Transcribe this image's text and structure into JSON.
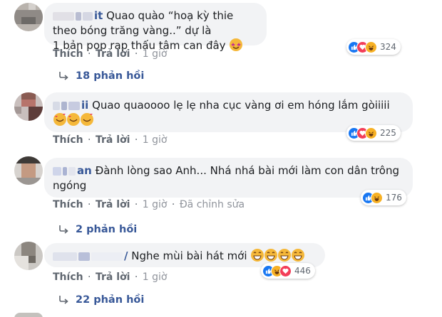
{
  "comments": [
    {
      "author_tail": "it",
      "text_line1": "Quao quào “hoạ kỳ thie theo bóng trăng vàng..” dự là",
      "text_line2": "1 bản pop rap thấu tâm can đây",
      "emoji": [
        "star-struck-emoji"
      ],
      "actions": {
        "like": "Thích",
        "reply": "Trả lời",
        "time": "1 giờ"
      },
      "reactions": [
        "like",
        "love",
        "haha"
      ],
      "reaction_count": "324",
      "replies_label": "18 phản hồi"
    },
    {
      "author_tail": "ii",
      "text_line1": "Quao quaoooo lẹ lẹ nha cục vàng ơi em hóng lắm gòiiiii",
      "text_line2": "",
      "emoji": [
        "heart-face-emoji",
        "heart-face-emoji",
        "heart-face-emoji"
      ],
      "actions": {
        "like": "Thích",
        "reply": "Trả lời",
        "time": "1 giờ"
      },
      "reactions": [
        "like",
        "love",
        "haha"
      ],
      "reaction_count": "225",
      "replies_label": ""
    },
    {
      "author_tail": "an",
      "text_line1": "Đành lòng sao Anh... Nhá nhá bài mới làm con dân trông",
      "text_line2": "ngóng",
      "emoji": [],
      "actions": {
        "like": "Thích",
        "reply": "Trả lời",
        "time": "1 giờ",
        "edited": "Đã chỉnh sửa"
      },
      "reactions": [
        "like",
        "haha"
      ],
      "reaction_count": "176",
      "replies_label": "2 phản hồi"
    },
    {
      "author_tail": "/",
      "text_line1": "Nghe mùi bài hát mới",
      "text_line2": "",
      "emoji": [
        "grin-emoji",
        "grin-emoji",
        "grin-emoji",
        "grin-emoji"
      ],
      "actions": {
        "like": "Thích",
        "reply": "Trả lời",
        "time": "1 giờ"
      },
      "reactions": [
        "like",
        "haha",
        "love"
      ],
      "reaction_count": "446",
      "replies_label": "22 phản hồi"
    }
  ],
  "colors": {
    "link": "#385898",
    "bubble": "#f2f3f5",
    "like": "#1877f2",
    "love": "#f33e58",
    "haha": "#f7b125"
  }
}
